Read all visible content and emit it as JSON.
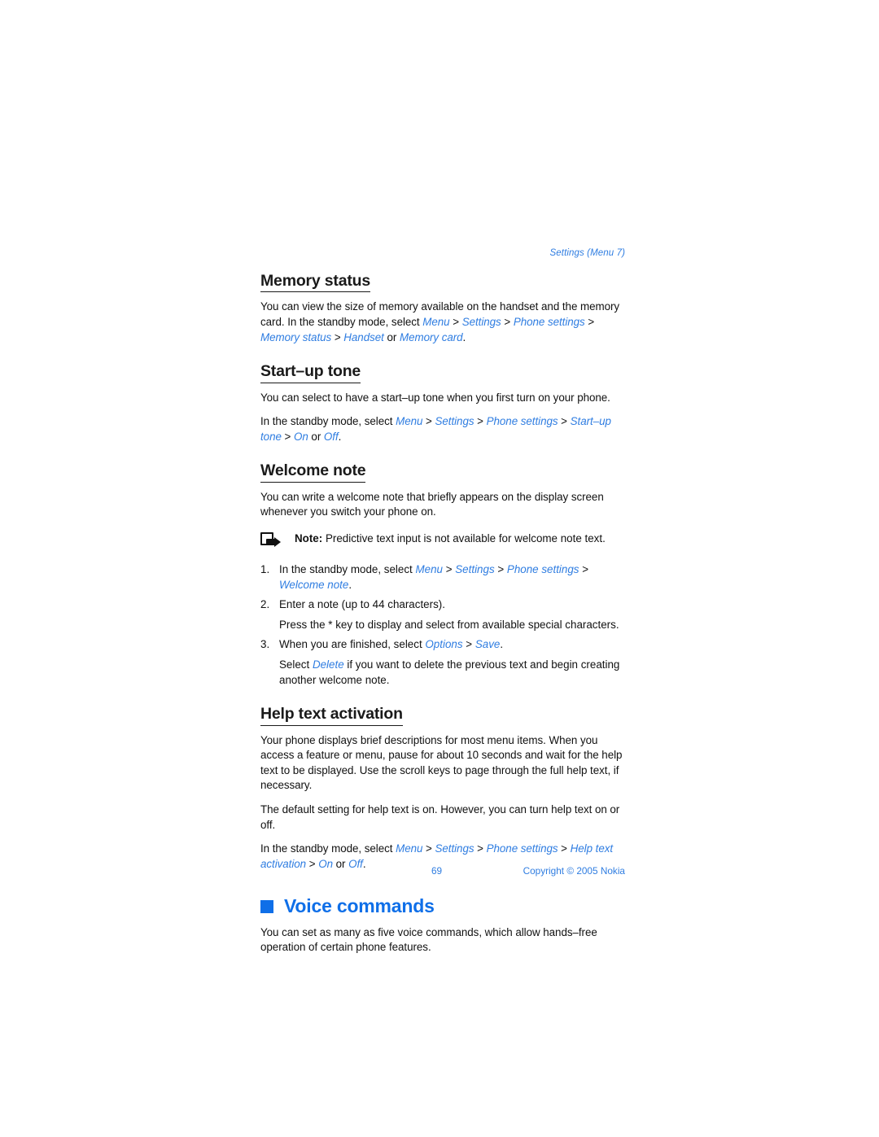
{
  "header": {
    "running_head": "Settings (Menu 7)"
  },
  "sections": [
    {
      "heading": "Memory status",
      "paragraphs": [
        {
          "id": "memory_p1",
          "runs": [
            {
              "t": "You can view the size of memory available on the handset and the memory card. In the standby mode, select ",
              "s": "plain"
            },
            {
              "t": "Menu",
              "s": "link"
            },
            {
              "t": " > ",
              "s": "sep"
            },
            {
              "t": "Settings",
              "s": "link"
            },
            {
              "t": " > ",
              "s": "sep"
            },
            {
              "t": "Phone settings",
              "s": "link"
            },
            {
              "t": " > ",
              "s": "sep"
            },
            {
              "t": "Memory status",
              "s": "link"
            },
            {
              "t": " > ",
              "s": "sep"
            },
            {
              "t": "Handset",
              "s": "link"
            },
            {
              "t": " or ",
              "s": "plain"
            },
            {
              "t": "Memory card",
              "s": "link"
            },
            {
              "t": ".",
              "s": "plain"
            }
          ]
        }
      ]
    },
    {
      "heading": "Start–up tone",
      "paragraphs": [
        {
          "id": "startup_p1",
          "runs": [
            {
              "t": "You can select to have a start–up tone when you first turn on your phone.",
              "s": "plain"
            }
          ]
        },
        {
          "id": "startup_p2",
          "runs": [
            {
              "t": "In the standby mode, select ",
              "s": "plain"
            },
            {
              "t": "Menu",
              "s": "link"
            },
            {
              "t": " > ",
              "s": "sep"
            },
            {
              "t": "Settings",
              "s": "link"
            },
            {
              "t": " > ",
              "s": "sep"
            },
            {
              "t": "Phone settings",
              "s": "link"
            },
            {
              "t": " > ",
              "s": "sep"
            },
            {
              "t": "Start–up tone",
              "s": "link"
            },
            {
              "t": " > ",
              "s": "sep"
            },
            {
              "t": "On",
              "s": "link"
            },
            {
              "t": " or ",
              "s": "plain"
            },
            {
              "t": "Off",
              "s": "link"
            },
            {
              "t": ".",
              "s": "plain"
            }
          ]
        }
      ]
    },
    {
      "heading": "Welcome note",
      "paragraphs": [
        {
          "id": "welcome_p1",
          "runs": [
            {
              "t": "You can write a welcome note that briefly appears on the display screen whenever you switch your phone on.",
              "s": "plain"
            }
          ]
        }
      ]
    },
    {
      "heading": "Help text activation",
      "paragraphs": [
        {
          "id": "help_p1",
          "runs": [
            {
              "t": "Your phone displays brief descriptions for most menu items. When you access a feature or menu, pause for about 10 seconds and wait for the help text to be displayed. Use the scroll keys to page through the full help text, if necessary.",
              "s": "plain"
            }
          ]
        },
        {
          "id": "help_p2",
          "runs": [
            {
              "t": "The default setting for help text is on. However, you can turn help text on or off.",
              "s": "plain"
            }
          ]
        },
        {
          "id": "help_p3",
          "runs": [
            {
              "t": "In the standby mode, select ",
              "s": "plain"
            },
            {
              "t": "Menu",
              "s": "link"
            },
            {
              "t": " > ",
              "s": "sep"
            },
            {
              "t": "Settings",
              "s": "link"
            },
            {
              "t": " > ",
              "s": "sep"
            },
            {
              "t": "Phone settings",
              "s": "link"
            },
            {
              "t": " > ",
              "s": "sep"
            },
            {
              "t": "Help text activation",
              "s": "link"
            },
            {
              "t": " > ",
              "s": "sep"
            },
            {
              "t": "On",
              "s": "link"
            },
            {
              "t": " or ",
              "s": "plain"
            },
            {
              "t": "Off",
              "s": "link"
            },
            {
              "t": ".",
              "s": "plain"
            }
          ]
        }
      ]
    }
  ],
  "note": {
    "icon": "note-pointer-icon",
    "label": "Note:",
    "text": " Predictive text input is not available for welcome note text."
  },
  "procedure": {
    "items": [
      {
        "number": "1.",
        "runs": [
          {
            "t": "In the standby mode, select ",
            "s": "plain"
          },
          {
            "t": "Menu",
            "s": "link"
          },
          {
            "t": " > ",
            "s": "sep"
          },
          {
            "t": "Settings",
            "s": "link"
          },
          {
            "t": " > ",
            "s": "sep"
          },
          {
            "t": "Phone settings",
            "s": "link"
          },
          {
            "t": " > ",
            "s": "sep"
          },
          {
            "t": "Welcome note",
            "s": "link"
          },
          {
            "t": ".",
            "s": "plain"
          }
        ]
      },
      {
        "number": "2.",
        "runs": [
          {
            "t": "Enter a note (up to 44 characters).",
            "s": "plain"
          }
        ],
        "sub": [
          {
            "t": "Press the * key to display and select from available special characters.",
            "s": "plain"
          }
        ]
      },
      {
        "number": "3.",
        "runs": [
          {
            "t": "When you are finished, select ",
            "s": "plain"
          },
          {
            "t": "Options",
            "s": "link"
          },
          {
            "t": " > ",
            "s": "sep"
          },
          {
            "t": "Save",
            "s": "link"
          },
          {
            "t": ".",
            "s": "plain"
          }
        ],
        "sub": [
          {
            "t": "Select ",
            "s": "plain"
          },
          {
            "t": "Delete",
            "s": "link"
          },
          {
            "t": " if you want to delete the previous text and begin creating another welcome note.",
            "s": "plain"
          }
        ]
      }
    ]
  },
  "chapter": {
    "bullet": "square-bullet-icon",
    "title": "Voice commands",
    "intro": "You can set as many as five voice commands, which allow hands–free operation of certain phone features."
  },
  "footer": {
    "page_number": "69",
    "copyright": "Copyright © 2005 Nokia"
  },
  "colors": {
    "link_blue": "#2f7de1",
    "chapter_blue": "#0f6fe8",
    "text_black": "#111111",
    "page_background": "#ffffff"
  }
}
